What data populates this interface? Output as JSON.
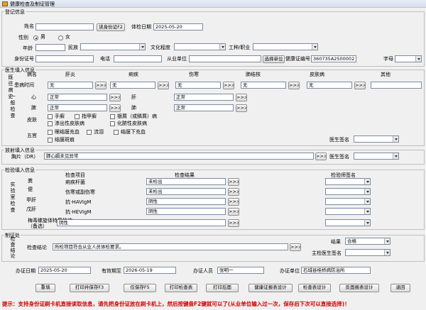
{
  "window": {
    "title": "健康检查及制证管理"
  },
  "reg": {
    "legend": "登记信息",
    "name_label": "姓名",
    "name_value": "",
    "read_id_btn": "读身份证F2",
    "exam_date_label": "体检日期",
    "exam_date_value": "2025-05-20",
    "sex_label": "性别",
    "male": "男",
    "female": "女",
    "age_label": "年龄",
    "ethnic_label": "民族",
    "edu_label": "文化程度",
    "job_label": "工种/职业",
    "id_label": "身份证号",
    "phone_label": "电话",
    "employer_label": "从业单位",
    "choose_employer_btn": "选择单位",
    "cert_no_label": "健康证编号",
    "cert_no_value": "360735A2500002",
    "word_label": "字母"
  },
  "doctor": {
    "legend": "医生填入信息",
    "history_label": "既往病史",
    "col_disease": "病名",
    "col_hepatitis": "肝炎",
    "col_dysentery": "痢疾",
    "col_typhoid": "伤寒",
    "col_tb": "肺结核",
    "col_skin": "皮肤病",
    "col_other": "其他",
    "onset_label": "患病时间",
    "none": "无",
    "general_label": "一般检查",
    "heart_label": "心",
    "liver_label": "肝",
    "spleen_label": "脾",
    "lung_label": "肺",
    "normal": "正常",
    "skin_label": "皮肤",
    "skin_opts": [
      "手癣",
      "指甲癣",
      "银屑（或鳞屑）病",
      "渗出性皮肤病",
      "化脓性皮肤病"
    ],
    "facial_label": "五官",
    "facial_opts": [
      "眼结膜充血",
      "流泪",
      "结膜下充血",
      "结膜斑痕"
    ],
    "doctor_sign_label": "医生签名"
  },
  "xray": {
    "legend": "放射填入信息",
    "chest_label": "胸片（DR）",
    "chest_value": "肺心膈未见异常",
    "doctor_sign_label": "医生签名"
  },
  "lab": {
    "legend": "检验填入信息",
    "side_label": "实验室检查",
    "col_item": "检查项目",
    "col_result": "检查结果",
    "col_sign": "检验师签名",
    "rows": [
      {
        "group": "粪",
        "item": "痢疾杆菌",
        "result": "未检出"
      },
      {
        "group": "便",
        "item": "伤寒或副伤寒",
        "result": "未检出"
      },
      {
        "group": "甲肝",
        "item": "抗-HAVIgM",
        "result": "阴性"
      },
      {
        "group": "戊肝",
        "item": "抗-HEVIgM",
        "result": "阴性"
      },
      {
        "group": "",
        "item": "梅毒螺旋体特异抗体（备选）",
        "result": "阴性"
      }
    ],
    "row_groups": [
      "粪",
      "",
      "甲肝",
      "戊肝",
      ""
    ]
  },
  "cert": {
    "legend": "制证处",
    "side_label": "检查结论",
    "conclusion_label": "检查结论",
    "conclusion_value": "所检项目符合从业人员体检要求。",
    "result_label": "结果",
    "result_value": "合格",
    "chief_label": "主检医生签名"
  },
  "footer": {
    "issue_date_label": "办证日期",
    "issue_date_value": "2025-05-20",
    "valid_label": "有效期至",
    "valid_value": "2026-05-19",
    "staff_label": "办证人员",
    "staff_value": "张明一",
    "unit_label": "办证单位",
    "unit_value": "石城县桂桥病防治所"
  },
  "buttons": [
    "重填",
    "打印并保存F3",
    "仅保存F5",
    "打印检查表",
    "打印后面",
    "健康证报表设计",
    "检查表设计",
    "反面报表设计",
    "退回"
  ],
  "tip": "提示：支持身份证刷卡机直接读取信息，请先把身份证放在刷卡机上，然后按键盘F2键就可以了(从业单位输入过一次，保存后下次可以直接选择)！",
  "icons": {
    "ellipsis": "ellipsis-icon",
    "dropdown": "chevron-down-icon",
    "app": "app-icon"
  }
}
